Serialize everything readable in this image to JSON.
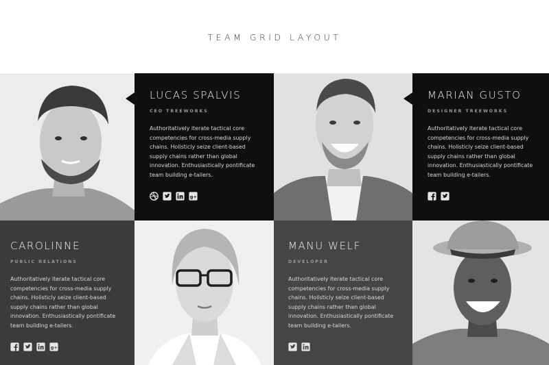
{
  "page": {
    "title": "TEAM GRID LAYOUT"
  },
  "members": [
    {
      "name": "LUCAS SPALVIS",
      "role": "CEO TREEWORKS",
      "bio": "Authoritatively iterate tactical core competencies for cross-media supply chains. Holisticly seize client-based supply chains rather than global innovation. Enthusiastically pontificate team building e-tailers.",
      "socials": [
        "dribbble-icon",
        "twitter-icon",
        "linkedin-icon",
        "google-plus-icon"
      ]
    },
    {
      "name": "MARIAN GUSTO",
      "role": "DESIGNER TREEWORKS",
      "bio": "Authoritatively iterate tactical core competencies for cross-media supply chains. Holisticly seize client-based supply chains rather than global innovation. Enthusiastically pontificate team building e-tailers.",
      "socials": [
        "facebook-icon",
        "twitter-icon"
      ]
    },
    {
      "name": "CAROLINNE",
      "role": "PUBLIC RELATIONS",
      "bio": "Authoritatively iterate tactical core competencies for cross-media supply chains. Holisticly seize client-based supply chains rather than global innovation. Enthusiastically pontificate team building e-tailers.",
      "socials": [
        "facebook-icon",
        "twitter-icon",
        "linkedin-icon",
        "google-plus-icon"
      ]
    },
    {
      "name": "MANU WELF",
      "role": "DEVELOPER",
      "bio": "Authoritatively iterate tactical core competencies for cross-media supply chains. Holisticly seize client-based supply chains rather than global innovation. Enthusiastically pontificate team building e-tailers.",
      "socials": [
        "twitter-icon",
        "linkedin-icon"
      ]
    }
  ],
  "colors": {
    "black": "#0f0f0f",
    "dark_grey": "#3b3b3b",
    "mid_grey": "#454545",
    "photo_bg": "#e9e9e9"
  }
}
